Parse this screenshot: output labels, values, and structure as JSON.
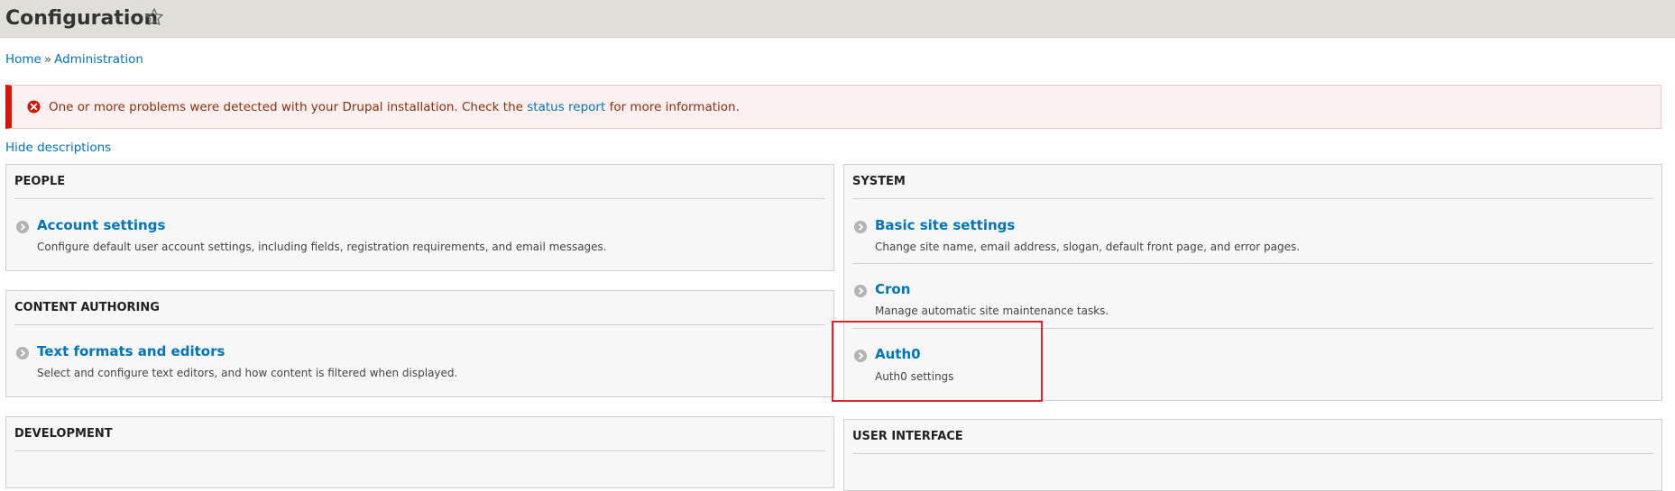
{
  "header": {
    "title": "Configuration"
  },
  "breadcrumb": {
    "home": "Home",
    "separator": "»",
    "admin": "Administration"
  },
  "message": {
    "text_before": "One or more problems were detected with your Drupal installation. Check the",
    "link": "status report",
    "text_after": "for more information."
  },
  "hide_descriptions": "Hide descriptions",
  "panels": {
    "people": {
      "title": "PEOPLE",
      "items": [
        {
          "label": "Account settings",
          "description": "Configure default user account settings, including fields, registration requirements, and email messages."
        }
      ]
    },
    "content_authoring": {
      "title": "CONTENT AUTHORING",
      "items": [
        {
          "label": "Text formats and editors",
          "description": "Select and configure text editors, and how content is filtered when displayed."
        }
      ]
    },
    "development": {
      "title": "DEVELOPMENT"
    },
    "system": {
      "title": "SYSTEM",
      "items": [
        {
          "label": "Basic site settings",
          "description": "Change site name, email address, slogan, default front page, and error pages."
        },
        {
          "label": "Cron",
          "description": "Manage automatic site maintenance tasks."
        },
        {
          "label": "Auth0",
          "description": "Auth0 settings"
        }
      ]
    },
    "user_interface": {
      "title": "USER INTERFACE"
    }
  },
  "colors": {
    "link": "#0074bd",
    "error": "#d81300",
    "highlight": "#d9252b",
    "header_bg": "#e0e0d8"
  }
}
